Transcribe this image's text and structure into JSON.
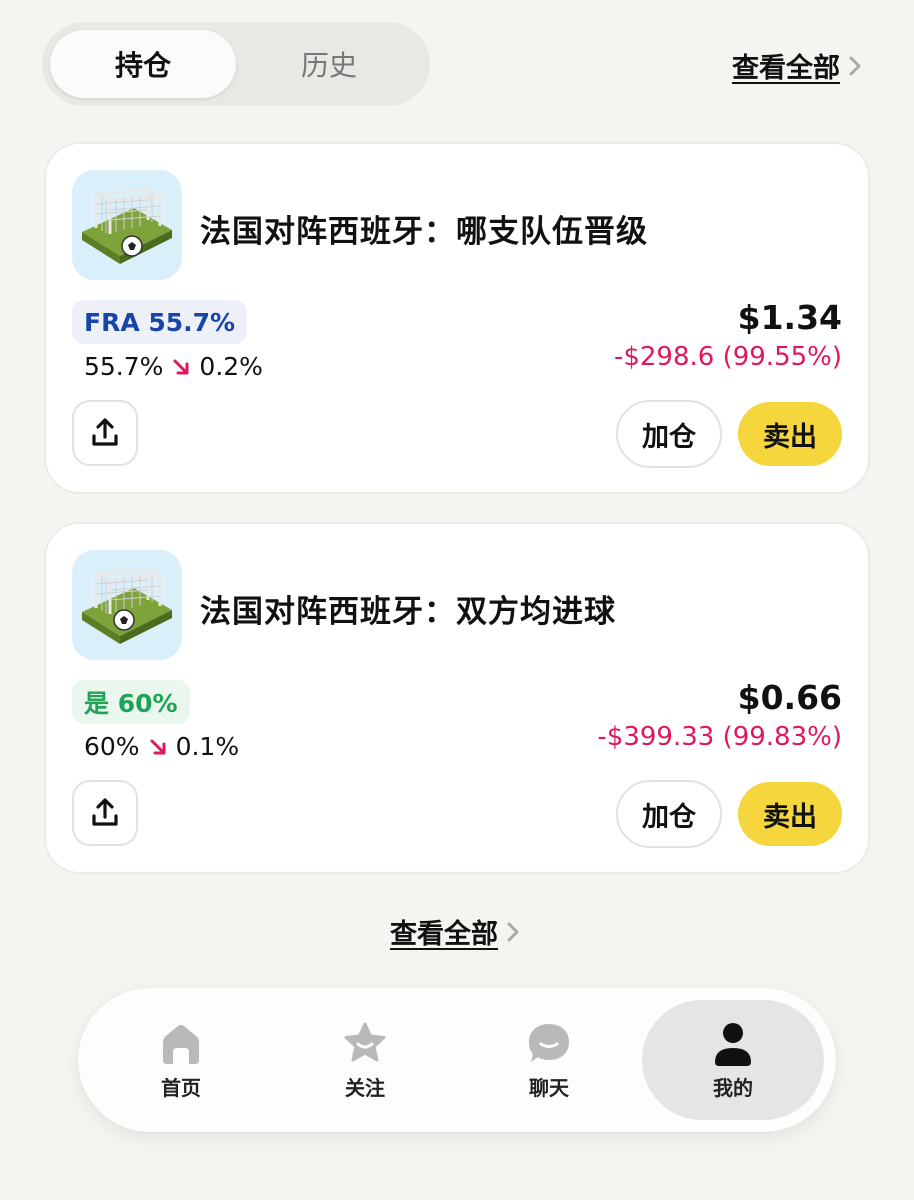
{
  "tabs": {
    "holdings": "持仓",
    "history": "历史"
  },
  "view_all": "查看全部",
  "positions": [
    {
      "title": "法国对阵西班牙：哪支队伍晋级",
      "badge": "FRA 55.7%",
      "badge_color": "#1845a7",
      "prob_from": "55.7%",
      "prob_delta": "0.2%",
      "price": "$1.34",
      "pnl": "-$298.6 (99.55%)",
      "add_label": "加仓",
      "sell_label": "卖出"
    },
    {
      "title": "法国对阵西班牙：双方均进球",
      "badge": "是 60%",
      "badge_color": "#1fa456",
      "prob_from": "60%",
      "prob_delta": "0.1%",
      "price": "$0.66",
      "pnl": "-$399.33 (99.83%)",
      "add_label": "加仓",
      "sell_label": "卖出"
    }
  ],
  "nav": [
    {
      "label": "首页",
      "icon": "home-icon"
    },
    {
      "label": "关注",
      "icon": "star-icon"
    },
    {
      "label": "聊天",
      "icon": "chat-icon"
    },
    {
      "label": "我的",
      "icon": "person-icon",
      "active": true
    }
  ],
  "colors": {
    "loss": "#e0185a",
    "sell_button": "#f5d63c",
    "background": "#f5f4f0"
  }
}
